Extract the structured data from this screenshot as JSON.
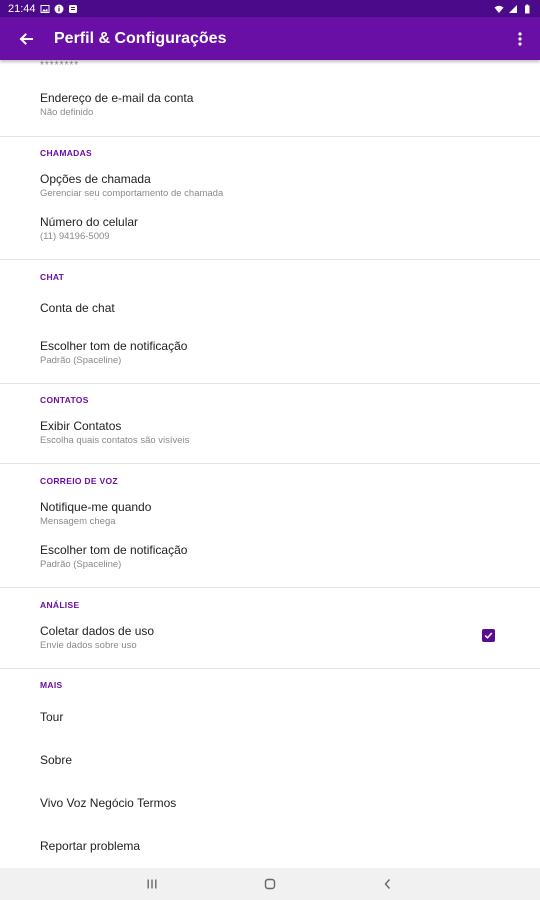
{
  "status_bar": {
    "time": "21:44",
    "icons_left": [
      "image-icon",
      "info-icon",
      "notification-icon"
    ],
    "icons_right": [
      "wifi-icon",
      "signal-icon",
      "battery-icon"
    ]
  },
  "app_bar": {
    "title": "Perfil & Configurações",
    "back_icon": "arrow-back-icon",
    "more_icon": "more-vert-icon",
    "color": "#6a0fa6"
  },
  "top_partial": "********",
  "account": {
    "email_title": "Endereço de e-mail da conta",
    "email_summary": "Não definido"
  },
  "chamadas": {
    "header": "CHAMADAS",
    "options_title": "Opções de chamada",
    "options_summary": "Gerenciar seu comportamento de chamada",
    "phone_title": "Número do celular",
    "phone_summary": "(11) 94196-5009"
  },
  "chat": {
    "header": "CHAT",
    "account_title": "Conta de chat",
    "tone_title": "Escolher tom de notificação",
    "tone_summary": "Padrão (Spaceline)"
  },
  "contatos": {
    "header": "CONTATOS",
    "show_title": "Exibir Contatos",
    "show_summary": "Escolha quais contatos são visíveis"
  },
  "correio_voz": {
    "header": "CORREIO DE VOZ",
    "notify_title": "Notifique-me quando",
    "notify_summary": "Mensagem chega",
    "tone_title": "Escolher tom de notificação",
    "tone_summary": "Padrão (Spaceline)"
  },
  "analise": {
    "header": "ANÁLISE",
    "collect_title": "Coletar dados de uso",
    "collect_summary": "Envie dados sobre uso",
    "collect_checked": true
  },
  "mais": {
    "header": "MAIS",
    "items": [
      "Tour",
      "Sobre",
      "Vivo Voz Negócio Termos",
      "Reportar problema"
    ]
  },
  "nav_bar": {
    "recents_icon": "recents-icon",
    "home_icon": "home-icon",
    "back_icon": "nav-back-icon"
  }
}
